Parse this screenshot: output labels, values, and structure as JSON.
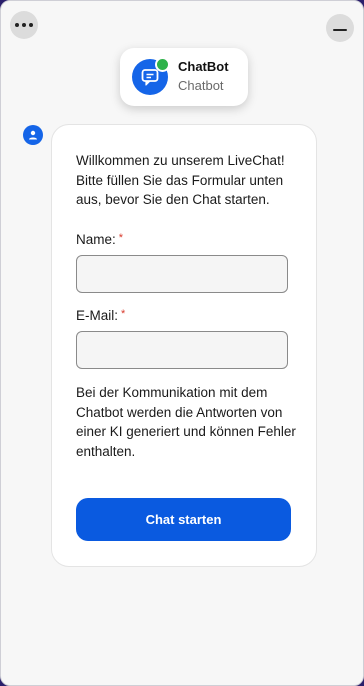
{
  "header": {
    "more_icon": "more-horizontal-icon",
    "minimize_icon": "minimize-icon",
    "bot_name": "ChatBot",
    "bot_subtitle": "Chatbot",
    "bot_avatar_icon": "chat-bubble-icon",
    "status_color": "#2eb24a"
  },
  "message": {
    "user_icon": "user-icon",
    "welcome_text": "Willkommen zu unserem LiveChat! Bitte füllen Sie das Formular unten aus, bevor Sie den Chat starten.",
    "name_label": "Name:",
    "email_label": "E-Mail:",
    "required_mark": "*",
    "name_value": "",
    "email_value": "",
    "disclaimer": "Bei der Kommunikation mit dem Chatbot werden die Antworten von einer KI generiert und können Fehler enthalten.",
    "start_button": "Chat starten"
  },
  "colors": {
    "accent": "#0a5ae0",
    "required": "#d8392b"
  }
}
